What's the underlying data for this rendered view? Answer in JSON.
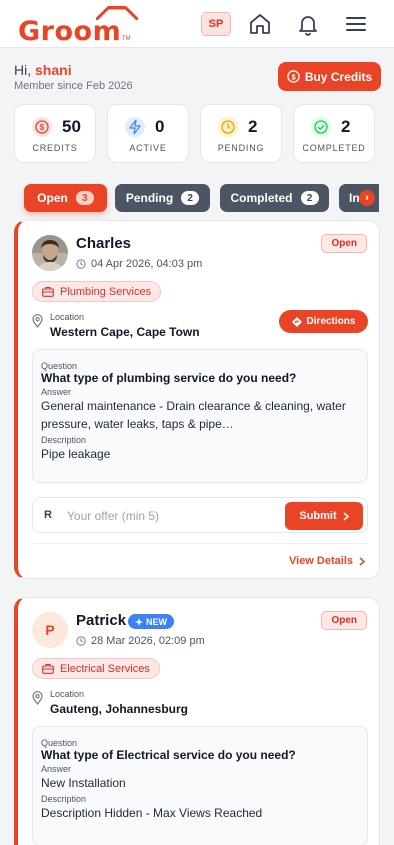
{
  "header": {
    "logo": "Groom",
    "logo_tm": "TM",
    "avatar_initials": "SP",
    "icons": [
      "home-icon",
      "bell-icon",
      "menu-icon"
    ]
  },
  "greeting": {
    "hi": "Hi,",
    "name": "shani",
    "member_since": "Member since Feb 2026",
    "buy_credits": "Buy Credits"
  },
  "stats": [
    {
      "value": "50",
      "label": "CREDITS",
      "color": "#ea4426"
    },
    {
      "value": "0",
      "label": "ACTIVE",
      "color": "#3b82f6"
    },
    {
      "value": "2",
      "label": "PENDING",
      "color": "#f59e0b"
    },
    {
      "value": "2",
      "label": "COMPLETED",
      "color": "#22c55e"
    }
  ],
  "tabs": [
    {
      "label": "Open",
      "count": "3"
    },
    {
      "label": "Pending",
      "count": "2"
    },
    {
      "label": "Completed",
      "count": "2"
    },
    {
      "label": "In",
      "count": ""
    }
  ],
  "leads": [
    {
      "name": "Charles",
      "date": "04 Apr 2026, 04:03 pm",
      "status": "Open",
      "service": "Plumbing Services",
      "location_label": "Location",
      "location": "Western Cape, Cape Town",
      "directions": "Directions",
      "question_label": "Question",
      "question": "What type of plumbing service do you need?",
      "answer_label": "Answer",
      "answer": "General maintenance - Drain clearance & cleaning, water pressure, water leaks, taps & pipe…",
      "description_label": "Description",
      "description": "Pipe leakage",
      "offer_currency": "R",
      "offer_placeholder": "Your offer (min 5)",
      "submit": "Submit",
      "view_details": "View Details"
    },
    {
      "name": "Patrick",
      "initial": "P",
      "badge": "NEW",
      "date": "28 Mar 2026, 02:09 pm",
      "status": "Open",
      "service": "Electrical Services",
      "location_label": "Location",
      "location": "Gauteng, Johannesburg",
      "question_label": "Question",
      "question": "What type of Electrical service do you need?",
      "answer_label": "Answer",
      "answer": "New Installation",
      "description_label": "Description",
      "description": "Description Hidden - Max Views Reached"
    }
  ]
}
